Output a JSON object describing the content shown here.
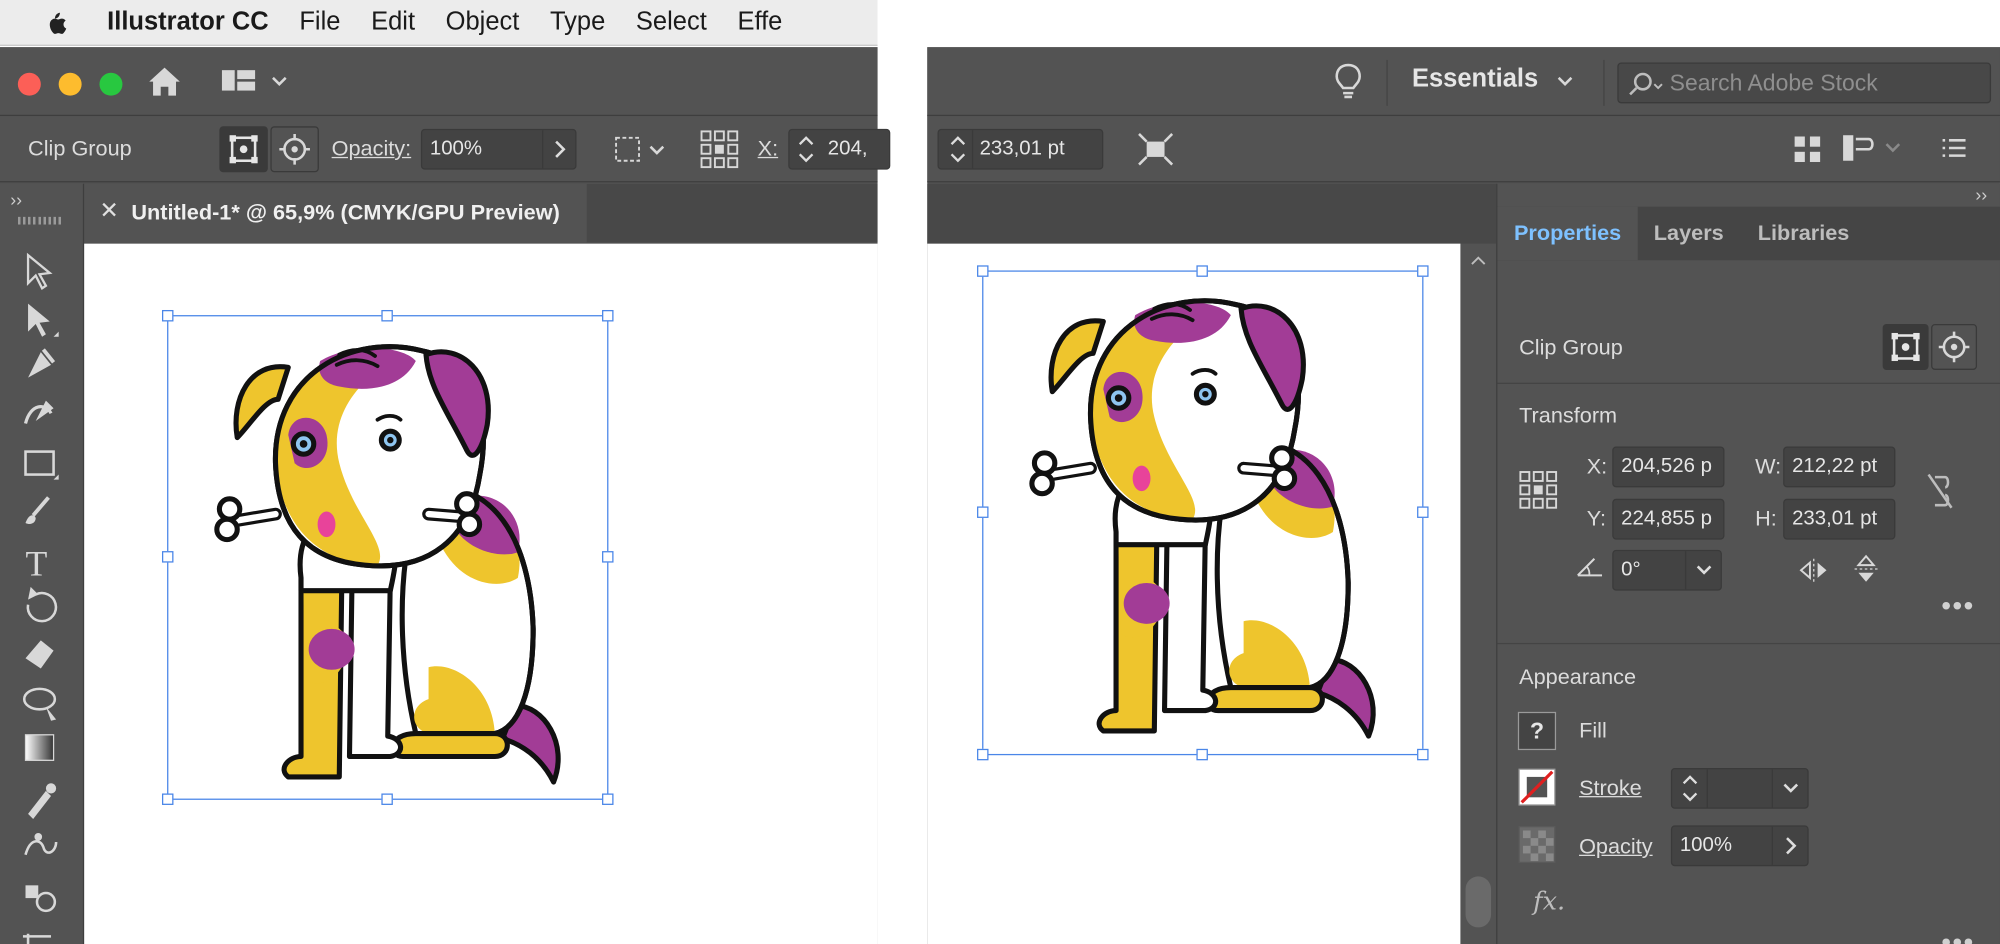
{
  "menubar": {
    "app_name": "Illustrator CC",
    "items": [
      "File",
      "Edit",
      "Object",
      "Type",
      "Select",
      "Effe"
    ]
  },
  "header": {
    "essentials_label": "Essentials",
    "search_placeholder": "Search Adobe Stock"
  },
  "control_bar": {
    "selection_label": "Clip Group",
    "opacity_label": "Opacity:",
    "opacity_value": "100%",
    "x_label": "X:",
    "x_value": "204,",
    "h_value": "233,01 pt"
  },
  "document": {
    "tab_title": "Untitled-1* @ 65,9% (CMYK/GPU Preview)"
  },
  "properties_panel": {
    "tabs": [
      "Properties",
      "Layers",
      "Libraries"
    ],
    "active_tab": "Properties",
    "selection_label": "Clip Group",
    "transform": {
      "title": "Transform",
      "x_label": "X:",
      "x_value": "204,526 p",
      "y_label": "Y:",
      "y_value": "224,855 p",
      "w_label": "W:",
      "w_value": "212,22 pt",
      "h_label": "H:",
      "h_value": "233,01 pt",
      "angle_value": "0°"
    },
    "appearance": {
      "title": "Appearance",
      "fill_label": "Fill",
      "stroke_label": "Stroke",
      "opacity_label": "Opacity",
      "opacity_value": "100%",
      "fx_label": "fx"
    }
  },
  "colors": {
    "panel_bg": "#535353",
    "accent_blue": "#7ec1ff",
    "selection_blue": "#4a86e8",
    "dog_yellow": "#eec52d",
    "dog_purple": "#a23c96"
  }
}
